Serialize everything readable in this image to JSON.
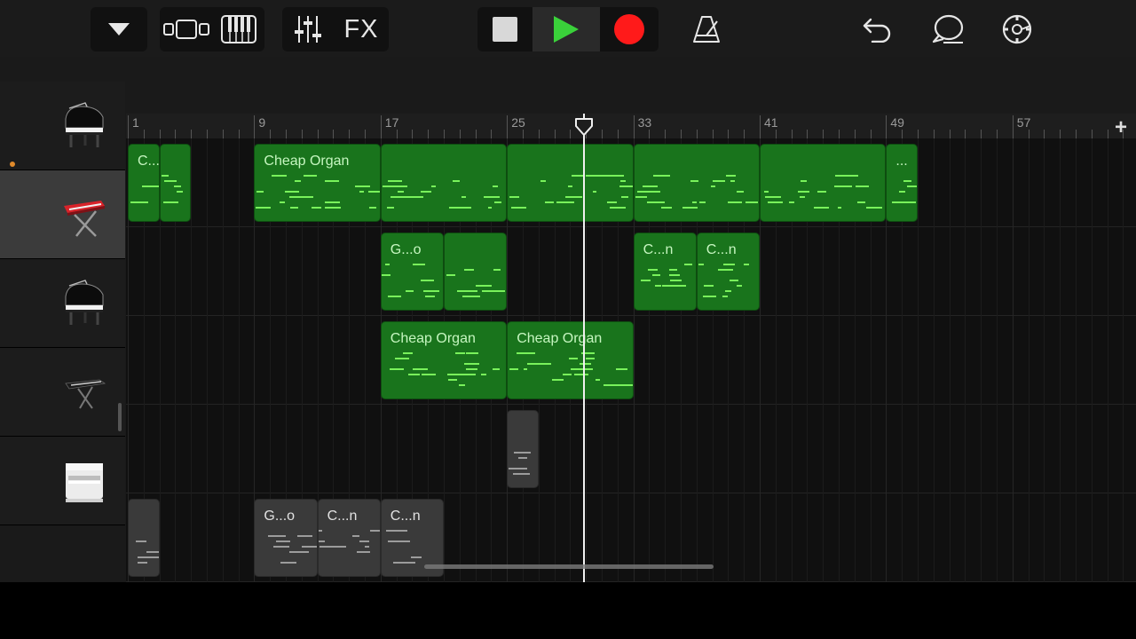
{
  "toolbar": {
    "fx_label": "FX",
    "icons": [
      "tracks-dropdown-icon",
      "track-view-icon",
      "keyboard-icon",
      "mixer-icon",
      "fx-button",
      "stop-icon",
      "play-icon",
      "record-icon",
      "metronome-icon",
      "undo-icon",
      "loop-browser-icon",
      "settings-icon"
    ]
  },
  "ruler": {
    "bar_labels": [
      "1",
      "9",
      "17",
      "25",
      "33",
      "41",
      "49",
      "57"
    ],
    "add_label": "+"
  },
  "colors": {
    "region_green": "#19741c",
    "note_green": "#79f25b",
    "record_red": "#ff1a1a",
    "play_green": "#3ad13a"
  },
  "tracks": [
    {
      "instrument": "grand-piano-icon",
      "selected": false
    },
    {
      "instrument": "red-stage-keyboard-icon",
      "selected": true
    },
    {
      "instrument": "grand-piano-icon",
      "selected": false
    },
    {
      "instrument": "synth-keyboard-icon",
      "selected": false
    },
    {
      "instrument": "upright-organ-icon",
      "selected": false
    }
  ],
  "regions": [
    {
      "track": 0,
      "bar": 1,
      "len": 2,
      "label": "C...n",
      "color": "green"
    },
    {
      "track": 0,
      "bar": 3,
      "len": 2,
      "label": "",
      "color": "green"
    },
    {
      "track": 0,
      "bar": 9,
      "len": 8,
      "label": "Cheap Organ",
      "color": "green"
    },
    {
      "track": 0,
      "bar": 17,
      "len": 8,
      "label": "",
      "color": "green"
    },
    {
      "track": 0,
      "bar": 25,
      "len": 8,
      "label": "",
      "color": "green"
    },
    {
      "track": 0,
      "bar": 33,
      "len": 8,
      "label": "",
      "color": "green"
    },
    {
      "track": 0,
      "bar": 41,
      "len": 8,
      "label": "",
      "color": "green"
    },
    {
      "track": 0,
      "bar": 49,
      "len": 2,
      "label": "...",
      "color": "green"
    },
    {
      "track": 1,
      "bar": 17,
      "len": 4,
      "label": "G...o",
      "color": "green"
    },
    {
      "track": 1,
      "bar": 21,
      "len": 4,
      "label": "",
      "color": "green"
    },
    {
      "track": 1,
      "bar": 33,
      "len": 4,
      "label": "C...n",
      "color": "green"
    },
    {
      "track": 1,
      "bar": 37,
      "len": 4,
      "label": "C...n",
      "color": "green"
    },
    {
      "track": 2,
      "bar": 17,
      "len": 8,
      "label": "Cheap Organ",
      "color": "green"
    },
    {
      "track": 2,
      "bar": 25,
      "len": 8,
      "label": "Cheap Organ",
      "color": "green"
    },
    {
      "track": 3,
      "bar": 25,
      "len": 2,
      "label": "",
      "color": "gray"
    },
    {
      "track": 4,
      "bar": 1,
      "len": 2,
      "label": "",
      "color": "gray"
    },
    {
      "track": 4,
      "bar": 9,
      "len": 4,
      "label": "G...o",
      "color": "gray"
    },
    {
      "track": 4,
      "bar": 13,
      "len": 4,
      "label": "C...n",
      "color": "gray"
    },
    {
      "track": 4,
      "bar": 17,
      "len": 4,
      "label": "C...n",
      "color": "gray"
    }
  ],
  "playhead_bar": 29.9
}
